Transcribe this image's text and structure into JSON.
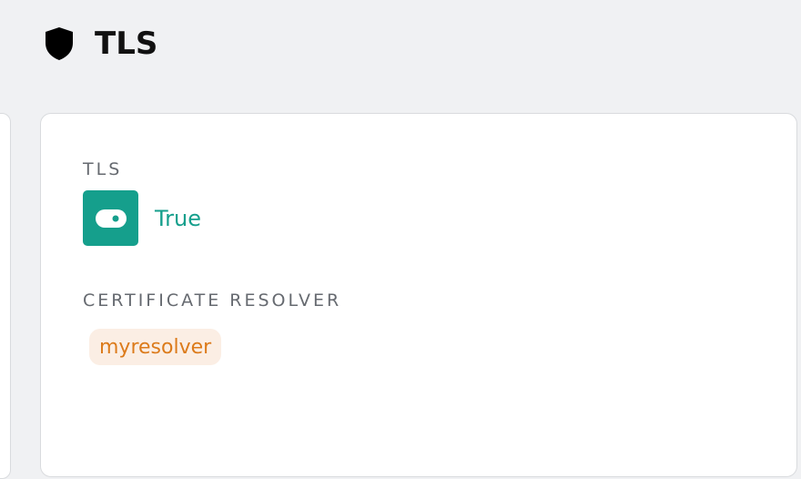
{
  "header": {
    "icon": "shield-icon",
    "title": "TLS"
  },
  "card": {
    "tls": {
      "label": "TLS",
      "icon": "toggle-on-icon",
      "value": "True",
      "color": "#159f8c"
    },
    "resolver": {
      "label": "CERTIFICATE RESOLVER",
      "value": "myresolver",
      "chip_color": "#dc7b1b",
      "chip_background": "#fbeee4"
    }
  }
}
